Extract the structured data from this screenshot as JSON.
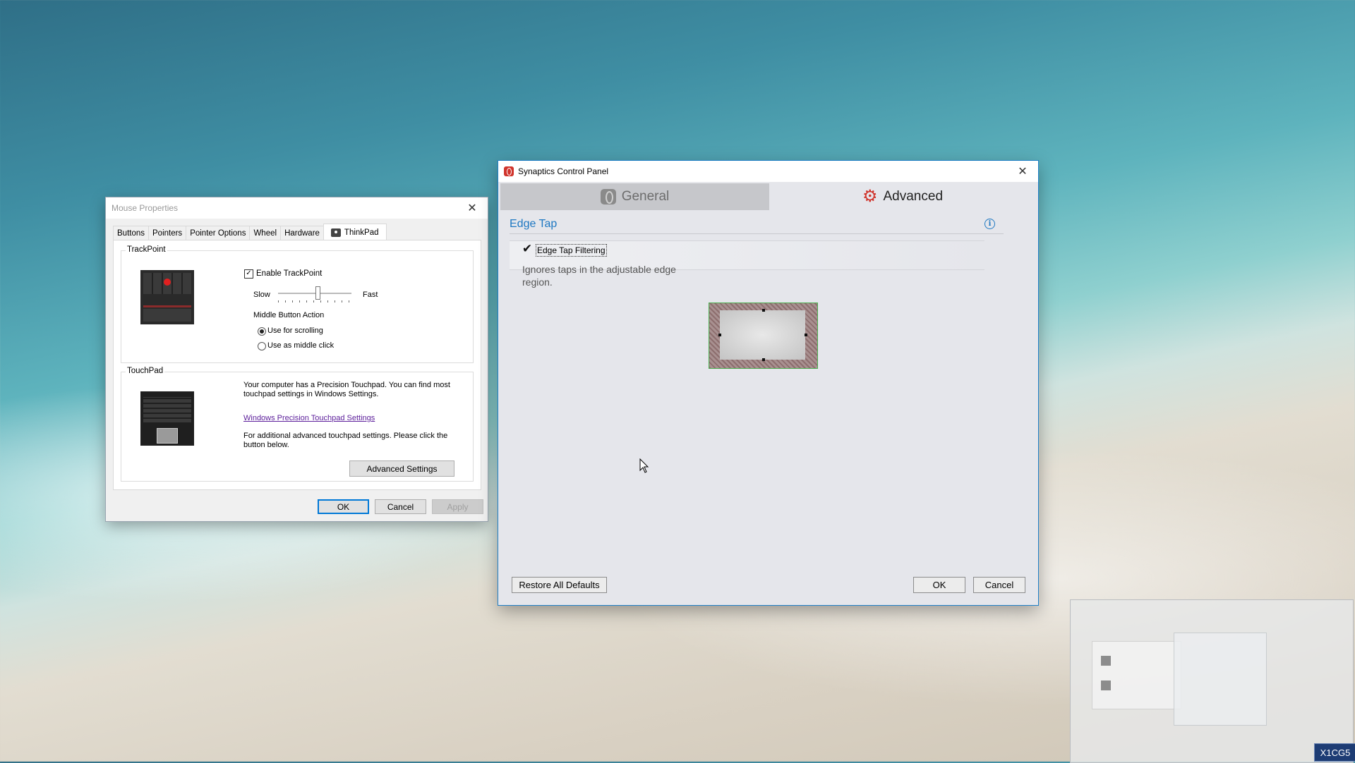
{
  "mouse_window": {
    "title": "Mouse Properties",
    "tabs": [
      "Buttons",
      "Pointers",
      "Pointer Options",
      "Wheel",
      "Hardware",
      "ThinkPad"
    ],
    "active_tab": "ThinkPad",
    "trackpoint": {
      "legend": "TrackPoint",
      "enable_label": "Enable TrackPoint",
      "enable_checked": true,
      "slow_label": "Slow",
      "fast_label": "Fast",
      "middle_button_label": "Middle Button Action",
      "option_scroll": "Use for scrolling",
      "option_middle": "Use as middle click",
      "selected_option": "Use for scrolling"
    },
    "touchpad": {
      "legend": "TouchPad",
      "description": "Your computer has a Precision Touchpad. You can find most touchpad settings in Windows Settings.",
      "link_text": "Windows Precision Touchpad Settings",
      "advanced_note": "For additional advanced touchpad settings. Please click the button below.",
      "advanced_button": "Advanced Settings"
    },
    "buttons": {
      "ok": "OK",
      "cancel": "Cancel",
      "apply": "Apply"
    }
  },
  "synaptics_window": {
    "title": "Synaptics Control Panel",
    "tabs": {
      "general": "General",
      "advanced": "Advanced"
    },
    "active_tab": "Advanced",
    "section_title": "Edge Tap",
    "edge_tap_filtering_label": "Edge Tap Filtering",
    "edge_tap_filtering_checked": true,
    "description": "Ignores taps in the adjustable edge region.",
    "buttons": {
      "restore": "Restore All Defaults",
      "ok": "OK",
      "cancel": "Cancel"
    }
  },
  "badge": "X1CG5",
  "colors": {
    "synaptics_accent": "#1e78c2",
    "synaptics_brand_red": "#d0342c",
    "link": "#5b1d9a"
  }
}
